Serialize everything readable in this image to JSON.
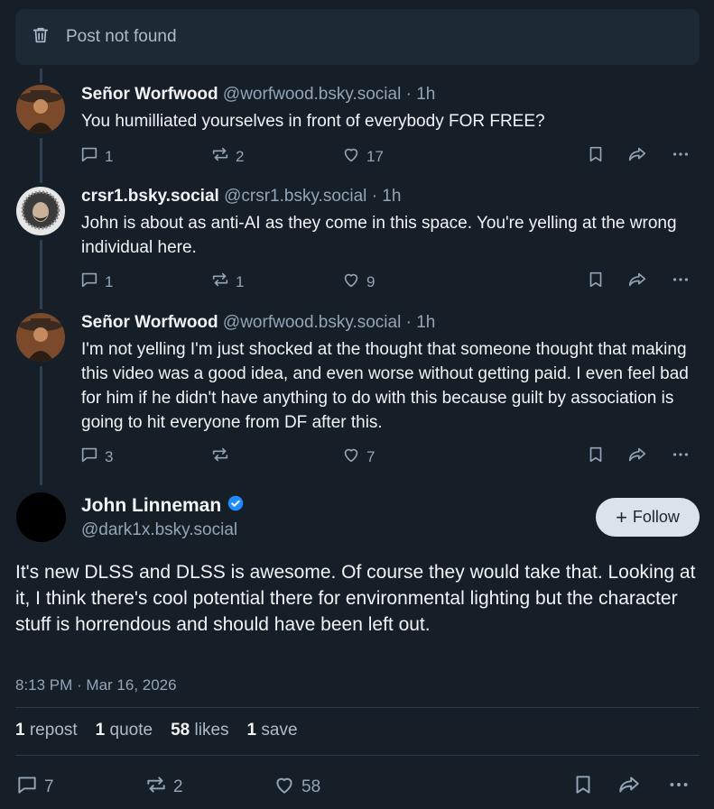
{
  "notfound": {
    "icon": "trash-icon",
    "text": "Post not found"
  },
  "replies": [
    {
      "name": "Señor Worfwood",
      "handle": "@worfwood.bsky.social",
      "time": "· 1h",
      "text": "You humilliated yourselves in front of everybody FOR FREE?",
      "replies": "1",
      "reposts": "2",
      "likes": "17"
    },
    {
      "name": "crsr1.bsky.social",
      "handle": "@crsr1.bsky.social",
      "time": "· 1h",
      "text": "John is about as anti-AI as they come in this space. You're yelling at the wrong individual here.",
      "replies": "1",
      "reposts": "1",
      "likes": "9"
    },
    {
      "name": "Señor Worfwood",
      "handle": "@worfwood.bsky.social",
      "time": "· 1h",
      "text": "I'm not yelling I'm just shocked at the thought that someone thought that making this video was a good idea, and even worse without getting paid. I even feel bad for him if he didn't have anything to do with this because guilt by association is going to hit everyone from DF after this.",
      "replies": "3",
      "reposts": "",
      "likes": "7"
    }
  ],
  "main": {
    "name": "John Linneman",
    "handle": "@dark1x.bsky.social",
    "follow_label": "Follow",
    "text": "It's new DLSS and DLSS is awesome. Of course they would take that. Looking at it, I think there's cool potential there for environmental lighting but the character stuff is horrendous and should have been left out.",
    "timestamp": "8:13 PM · Mar 16, 2026",
    "stats": {
      "reposts_count": "1",
      "reposts_label": "repost",
      "quotes_count": "1",
      "quotes_label": "quote",
      "likes_count": "58",
      "likes_label": "likes",
      "saves_count": "1",
      "saves_label": "save"
    },
    "actions": {
      "replies": "7",
      "reposts": "2",
      "likes": "58"
    }
  },
  "colors": {
    "background": "#161e27",
    "muted": "#93a5b7",
    "verified": "#208bfe"
  }
}
